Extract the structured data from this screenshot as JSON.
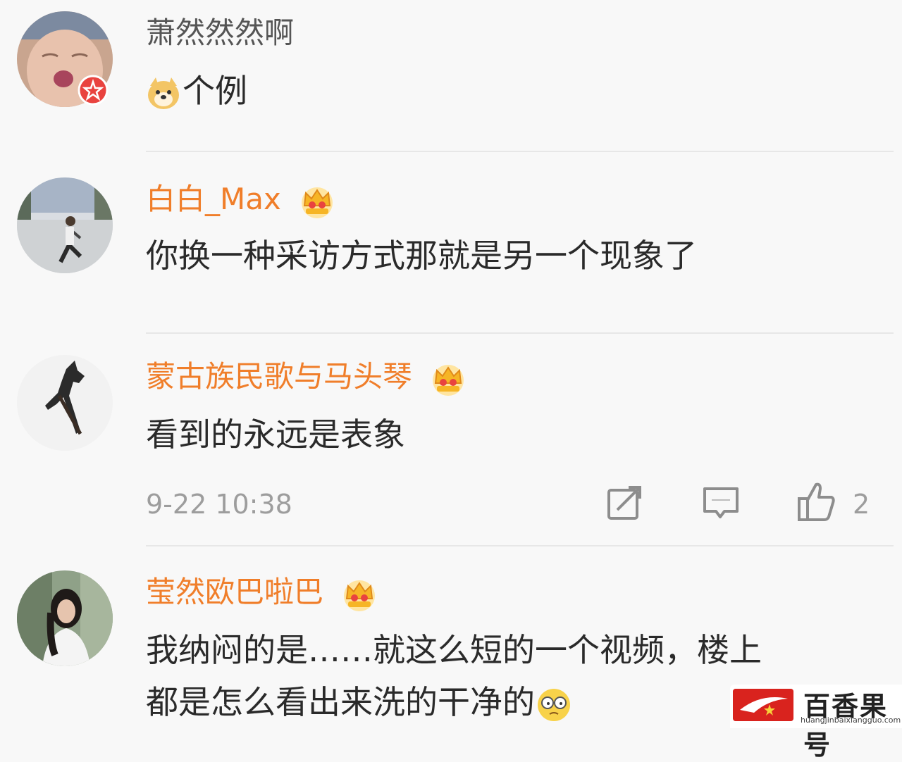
{
  "comments": [
    {
      "name": "萧然然然啊",
      "text": "个例"
    },
    {
      "name": "白白_Max",
      "text": "你换一种采访方式那就是另一个现象了"
    },
    {
      "name": "蒙古族民歌与马头琴",
      "text": "看到的永远是表象",
      "time": "9-22 10:38",
      "likes": "2"
    },
    {
      "name": "莹然欧巴啦巴",
      "text_line1": "我纳闷的是……就这么短的一个视频，楼上",
      "text_line2": "都是怎么看出来洗的干净的"
    }
  ],
  "watermark": {
    "cn": "百香果号",
    "url": "huangjinbaixiangguo.com"
  },
  "colors": {
    "name_vip": "#f07e2a",
    "name_normal": "#555555",
    "meta": "#9d9d9d"
  }
}
